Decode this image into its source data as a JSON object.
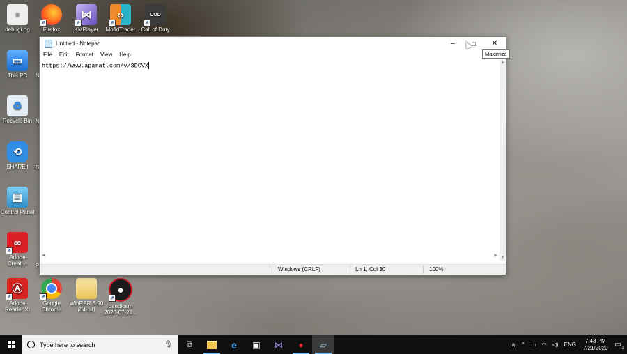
{
  "desktop": {
    "icons": [
      {
        "label": "debugLog",
        "icon": "text-file-icon",
        "color": "#e8e8e8"
      },
      {
        "label": "Firefox",
        "icon": "firefox-icon",
        "color": "#ff7139"
      },
      {
        "label": "KMPlayer",
        "icon": "kmplayer-icon",
        "color": "#7a5cc7"
      },
      {
        "label": "MofidTrader",
        "icon": "mofidtrader-icon",
        "color": "#e89a3c"
      },
      {
        "label": "Call of Duty",
        "icon": "call-of-duty-icon",
        "color": "#4a4a4a"
      },
      {
        "label": "This PC",
        "icon": "computer-icon",
        "color": "#3a8ee6"
      },
      {
        "label": "Recycle Bin",
        "icon": "recycle-bin-icon",
        "color": "#d8e6f0"
      },
      {
        "label": "SHAREit",
        "icon": "shareit-icon",
        "color": "#2f8de4"
      },
      {
        "label": "Control Panel",
        "icon": "control-panel-icon",
        "color": "#3fa3d9"
      },
      {
        "label": "Adobe Creati...",
        "icon": "adobe-cc-icon",
        "color": "#da1f26"
      },
      {
        "label": "Adobe Reader XI",
        "icon": "adobe-reader-icon",
        "color": "#d7241f"
      },
      {
        "label": "Google Chrome",
        "icon": "chrome-icon",
        "color": "#4285f4"
      },
      {
        "label": "WinRAR 5.90 (64-bit)",
        "icon": "folder-icon",
        "color": "#f0d27a"
      },
      {
        "label": "bandicam 2020-07-21...",
        "icon": "bandicam-icon",
        "color": "#c8202a"
      }
    ],
    "edge_letters": [
      "N",
      "N",
      "B",
      "P"
    ]
  },
  "notepad": {
    "title": "Untitled - Notepad",
    "menu": [
      "File",
      "Edit",
      "Format",
      "View",
      "Help"
    ],
    "content": "https://www.aparat.com/v/3DCVX",
    "controls": {
      "minimize": "–",
      "maximize": "□",
      "close": "✕"
    },
    "tooltip": "Maximize",
    "status": {
      "line_ending": "Windows (CRLF)",
      "position": "Ln 1, Col 30",
      "zoom": "100%"
    }
  },
  "taskbar": {
    "search_placeholder": "Type here to search",
    "apps": [
      {
        "name": "task-view-icon",
        "glyph": "⧉"
      },
      {
        "name": "file-explorer-icon",
        "glyph": "▬"
      },
      {
        "name": "edge-icon",
        "glyph": "e"
      },
      {
        "name": "store-icon",
        "glyph": "▣"
      },
      {
        "name": "kmplayer-taskbar-icon",
        "glyph": "⋈"
      },
      {
        "name": "bandicam-taskbar-icon",
        "glyph": "●"
      },
      {
        "name": "notepad-taskbar-icon",
        "glyph": "▱"
      }
    ],
    "tray": {
      "language": "ENG",
      "time": "7:43 PM",
      "date": "7/21/2020",
      "notifications": "3"
    }
  },
  "colors": {
    "taskbar": "#101010",
    "accent": "#76b9ed",
    "window_border": "#7a7a7a"
  }
}
